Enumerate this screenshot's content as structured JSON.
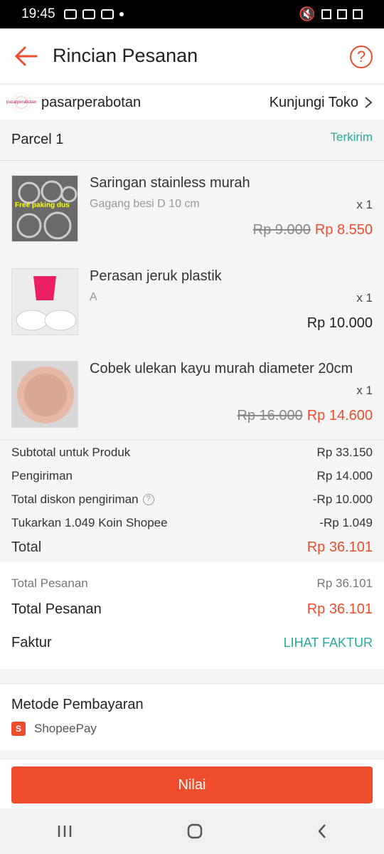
{
  "status": {
    "time": "19:45"
  },
  "header": {
    "title": "Rincian Pesanan"
  },
  "shop": {
    "name": "pasarperabotan",
    "visit_label": "Kunjungi Toko",
    "logo_text": "pasarperabotan"
  },
  "parcel": {
    "title": "Parcel 1",
    "status": "Terkirim",
    "items": [
      {
        "name": "Saringan stainless murah",
        "variant": "Gagang besi D 10 cm",
        "qty": "x 1",
        "original_price": "Rp 9.000",
        "price": "Rp 8.550",
        "thumb_caption": "Free paking dus"
      },
      {
        "name": "Perasan jeruk plastik",
        "variant": "A",
        "qty": "x 1",
        "original_price": "",
        "price": "Rp 10.000"
      },
      {
        "name": "Cobek ulekan kayu murah diameter 20cm",
        "variant": "",
        "qty": "x 1",
        "original_price": "Rp 16.000",
        "price": "Rp 14.600"
      }
    ]
  },
  "summary": {
    "subtotal_label": "Subtotal untuk Produk",
    "subtotal_value": "Rp 33.150",
    "shipping_label": "Pengiriman",
    "shipping_value": "Rp 14.000",
    "shipping_discount_label": "Total diskon pengiriman",
    "shipping_discount_value": "-Rp 10.000",
    "coins_label": "Tukarkan 1.049 Koin Shopee",
    "coins_value": "-Rp 1.049",
    "total_label": "Total",
    "total_value": "Rp 36.101"
  },
  "order": {
    "total_label_1": "Total Pesanan",
    "total_value_1": "Rp 36.101",
    "total_label_2": "Total Pesanan",
    "total_value_2": "Rp 36.101",
    "invoice_label": "Faktur",
    "invoice_link": "LIHAT FAKTUR"
  },
  "payment": {
    "title": "Metode Pembayaran",
    "method": "ShopeePay"
  },
  "action": {
    "button_label": "Nilai"
  },
  "colors": {
    "accent": "#ee4d2d",
    "teal": "#26aa99"
  }
}
